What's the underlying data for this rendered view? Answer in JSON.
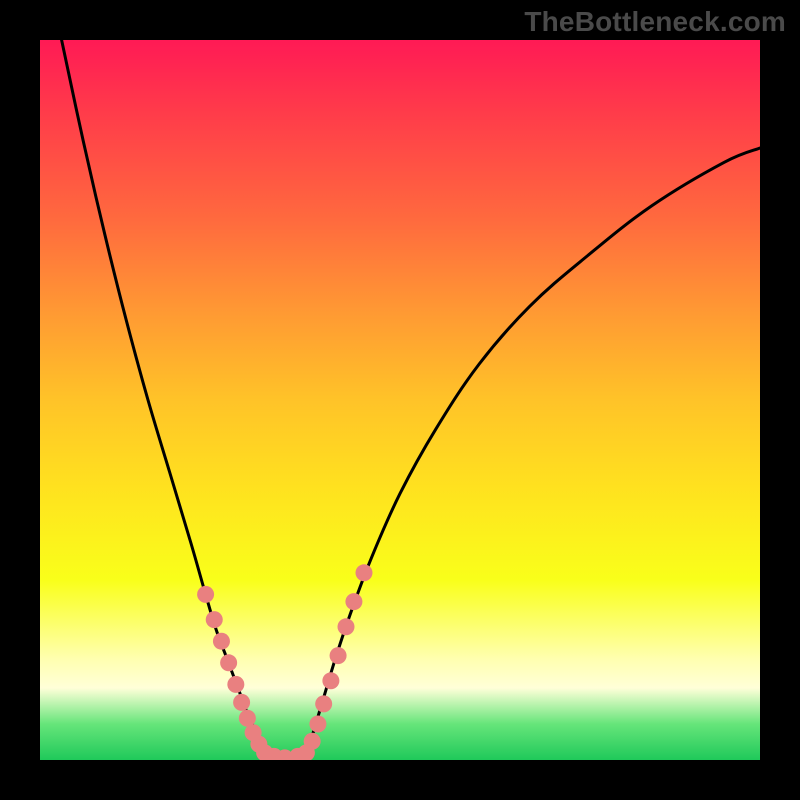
{
  "watermark": "TheBottleneck.com",
  "chart_data": {
    "type": "line",
    "title": "",
    "xlabel": "",
    "ylabel": "",
    "xlim": [
      0,
      100
    ],
    "ylim": [
      0,
      100
    ],
    "series": [
      {
        "name": "left-curve",
        "x": [
          3,
          6,
          9,
          12,
          15,
          18,
          21,
          23,
          24.5,
          26,
          27.5,
          29,
          30.5,
          31.5
        ],
        "y": [
          100,
          86,
          73,
          61,
          50,
          40,
          30,
          23,
          18,
          14,
          10,
          6,
          3,
          0.5
        ]
      },
      {
        "name": "right-curve",
        "x": [
          37,
          38,
          39.5,
          41,
          43,
          46,
          50,
          55,
          61,
          68,
          76,
          85,
          95,
          100
        ],
        "y": [
          0.5,
          4,
          9,
          14,
          20,
          28,
          37,
          46,
          55,
          63,
          70,
          77,
          83,
          85
        ]
      },
      {
        "name": "valley-floor",
        "x": [
          31.5,
          34,
          37
        ],
        "y": [
          0.5,
          0.2,
          0.5
        ]
      }
    ],
    "markers": [
      {
        "x": 23.0,
        "y": 23.0
      },
      {
        "x": 24.2,
        "y": 19.5
      },
      {
        "x": 25.2,
        "y": 16.5
      },
      {
        "x": 26.2,
        "y": 13.5
      },
      {
        "x": 27.2,
        "y": 10.5
      },
      {
        "x": 28.0,
        "y": 8.0
      },
      {
        "x": 28.8,
        "y": 5.8
      },
      {
        "x": 29.6,
        "y": 3.8
      },
      {
        "x": 30.4,
        "y": 2.2
      },
      {
        "x": 31.2,
        "y": 1.0
      },
      {
        "x": 32.5,
        "y": 0.5
      },
      {
        "x": 34.0,
        "y": 0.3
      },
      {
        "x": 35.8,
        "y": 0.5
      },
      {
        "x": 37.0,
        "y": 1.0
      },
      {
        "x": 37.8,
        "y": 2.6
      },
      {
        "x": 38.6,
        "y": 5.0
      },
      {
        "x": 39.4,
        "y": 7.8
      },
      {
        "x": 40.4,
        "y": 11.0
      },
      {
        "x": 41.4,
        "y": 14.5
      },
      {
        "x": 42.5,
        "y": 18.5
      },
      {
        "x": 43.6,
        "y": 22.0
      },
      {
        "x": 45.0,
        "y": 26.0
      }
    ],
    "marker_color": "#e98080",
    "curve_color": "#000000"
  }
}
